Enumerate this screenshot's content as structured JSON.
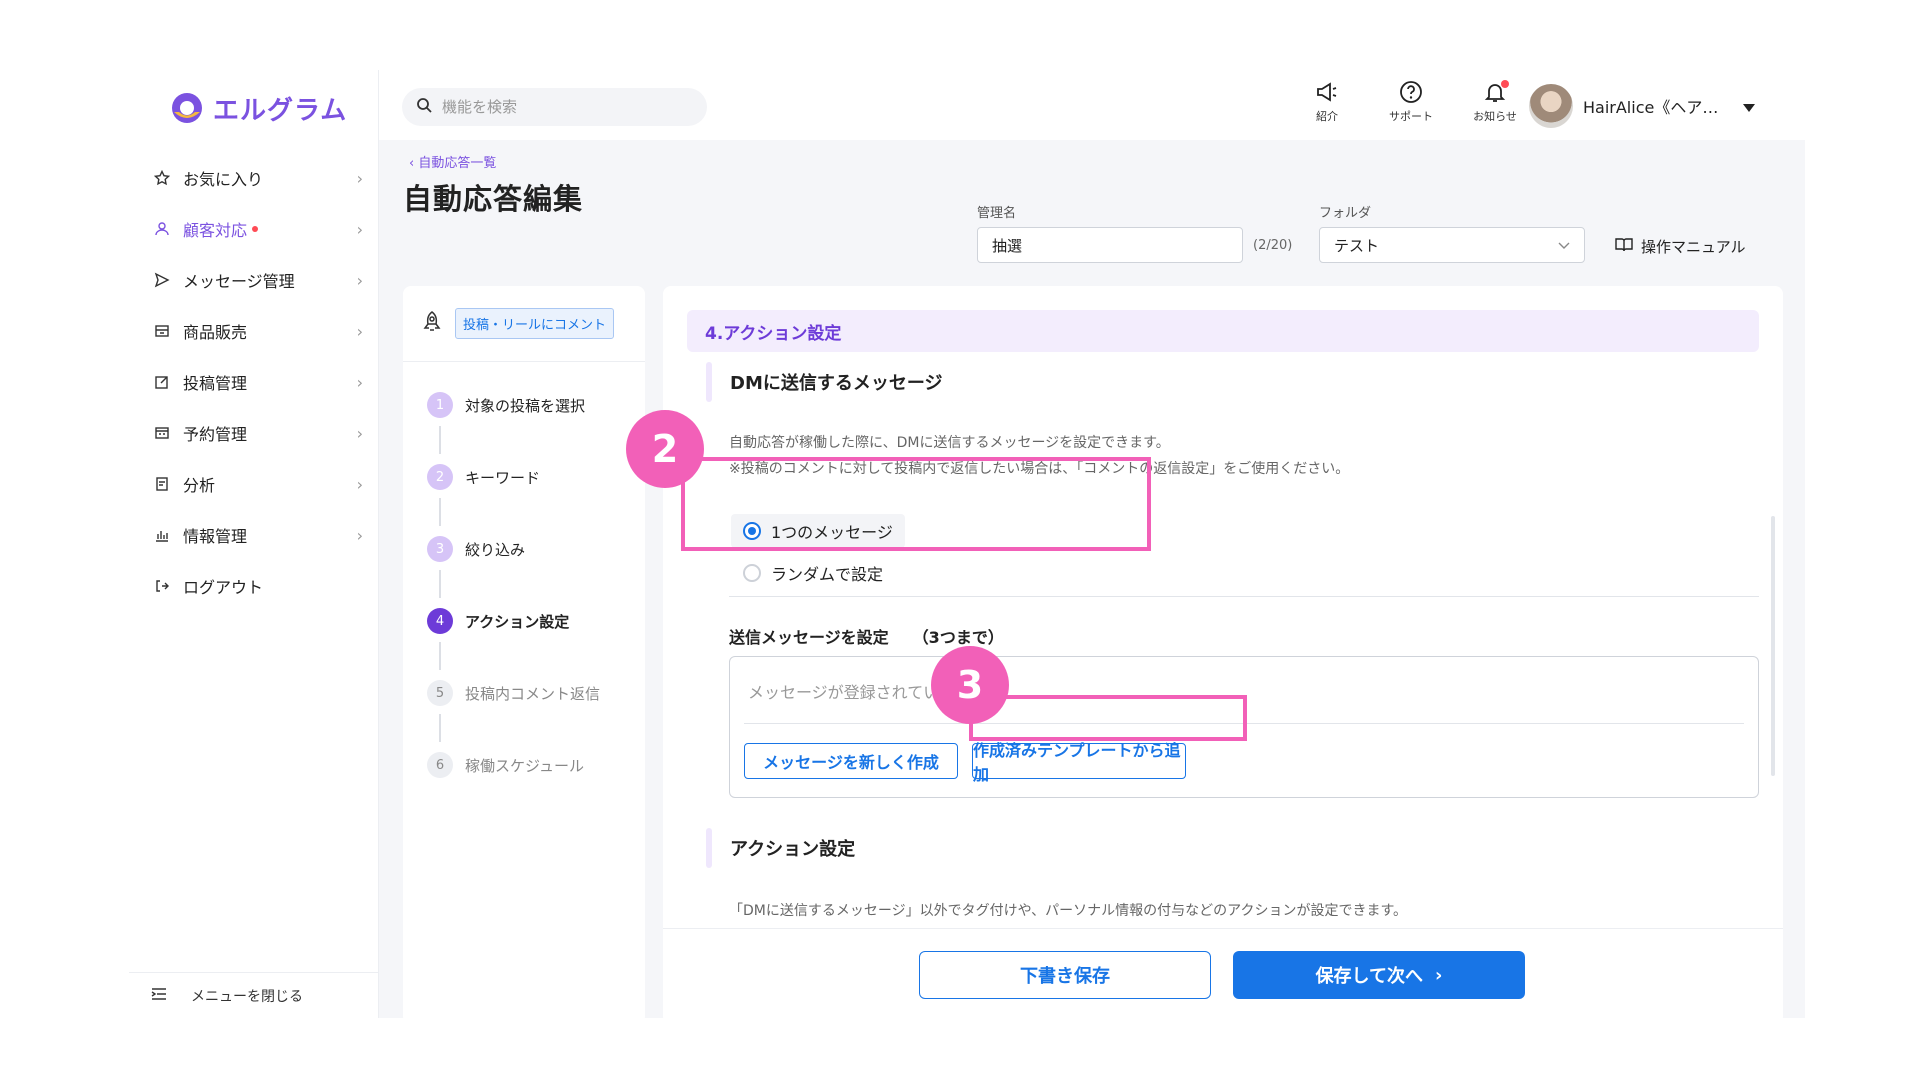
{
  "app": {
    "logo_text": "エルグラム",
    "brand_color": "#7b52e0",
    "accent_color": "#1875e6"
  },
  "sidebar": {
    "items": [
      {
        "label": "お気に入り",
        "icon": "star-icon"
      },
      {
        "label": "顧客対応",
        "icon": "person-icon",
        "active": true,
        "has_dot": true
      },
      {
        "label": "メッセージ管理",
        "icon": "send-icon"
      },
      {
        "label": "商品販売",
        "icon": "store-icon"
      },
      {
        "label": "投稿管理",
        "icon": "edit-icon"
      },
      {
        "label": "予約管理",
        "icon": "calendar-icon"
      },
      {
        "label": "分析",
        "icon": "report-icon"
      },
      {
        "label": "情報管理",
        "icon": "bar-chart-icon"
      },
      {
        "label": "ログアウト",
        "icon": "logout-icon"
      }
    ],
    "close_menu_label": "メニューを閉じる"
  },
  "header": {
    "search_placeholder": "機能を検索",
    "icons": [
      {
        "label": "紹介",
        "icon": "megaphone-icon"
      },
      {
        "label": "サポート",
        "icon": "help-icon"
      },
      {
        "label": "お知らせ",
        "icon": "bell-icon"
      }
    ],
    "user_name": "HairAlice《ヘアア…"
  },
  "page": {
    "breadcrumb": "自動応答一覧",
    "title": "自動応答編集",
    "name_label": "管理名",
    "name_value": "抽選",
    "name_counter": "(2/20)",
    "folder_label": "フォルダ",
    "folder_value": "テスト",
    "manual_label": "操作マニュアル"
  },
  "steps": {
    "trigger_tag": "投稿・リールにコメント",
    "items": [
      {
        "num": "1",
        "label": "対象の投稿を選択",
        "state": "done"
      },
      {
        "num": "2",
        "label": "キーワード",
        "state": "done"
      },
      {
        "num": "3",
        "label": "絞り込み",
        "state": "done"
      },
      {
        "num": "4",
        "label": "アクション設定",
        "state": "current"
      },
      {
        "num": "5",
        "label": "投稿内コメント返信",
        "state": "todo"
      },
      {
        "num": "6",
        "label": "稼働スケジュール",
        "state": "todo"
      }
    ]
  },
  "content": {
    "section_title": "4.アクション設定",
    "dm_heading": "DMに送信するメッセージ",
    "dm_desc_1": "自動応答が稼働した際に、DMに送信するメッセージを設定できます。",
    "dm_desc_2": "※投稿のコメントに対して投稿内で返信したい場合は、「コメントの返信設定」をご使用ください。",
    "radio_single": "1つのメッセージ",
    "radio_random": "ランダムで設定",
    "send_label": "送信メッセージを設定　　（3つまで）",
    "empty_text": "メッセージが登録されていません",
    "new_message_button": "メッセージを新しく作成",
    "template_button": "作成済みテンプレートから追加",
    "action_heading": "アクション設定",
    "action_desc": "「DMに送信するメッセージ」以外でタグ付けや、パーソナル情報の付与などのアクションが設定できます。",
    "draft_button": "下書き保存",
    "next_button": "保存して次へ"
  },
  "annotations": {
    "badge_2": "2",
    "badge_3": "3",
    "color": "#f260b8"
  }
}
